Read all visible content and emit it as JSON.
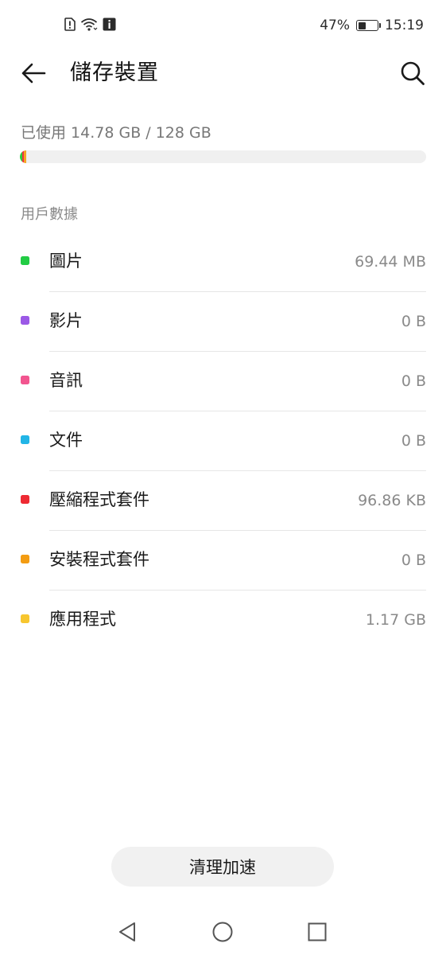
{
  "status_bar": {
    "battery_percent_text": "47%",
    "battery_level": 0.47,
    "time": "15:19",
    "icons": [
      "sim-alert-icon",
      "wifi-icon",
      "info-icon",
      "battery-icon"
    ]
  },
  "app_bar": {
    "title": "儲存裝置",
    "back_icon": "arrow-left-icon",
    "search_icon": "search-icon"
  },
  "storage": {
    "used_text": "已使用 14.78 GB / 128 GB",
    "used_fraction": 0.1155,
    "bar_segments": [
      {
        "name": "圖片",
        "color": "#2ecc40",
        "fraction": 0.006
      },
      {
        "name": "壓縮程式套件",
        "color": "#ee3344",
        "fraction": 0.004
      },
      {
        "name": "應用程式",
        "color": "#f5a623",
        "fraction": 0.006
      }
    ]
  },
  "section": {
    "header": "用戶數據"
  },
  "categories": [
    {
      "label": "圖片",
      "value": "69.44 MB",
      "color": "#22cc44"
    },
    {
      "label": "影片",
      "value": "0 B",
      "color": "#9b59e6"
    },
    {
      "label": "音訊",
      "value": "0 B",
      "color": "#f2558f"
    },
    {
      "label": "文件",
      "value": "0 B",
      "color": "#22b5e6"
    },
    {
      "label": "壓縮程式套件",
      "value": "96.86 KB",
      "color": "#ee2a33"
    },
    {
      "label": "安裝程式套件",
      "value": "0 B",
      "color": "#f39c12"
    },
    {
      "label": "應用程式",
      "value": "1.17 GB",
      "color": "#f7c62f"
    }
  ],
  "actions": {
    "clean_button": "清理加速"
  },
  "nav_bar": {
    "back_icon": "triangle-back-icon",
    "home_icon": "circle-home-icon",
    "recents_icon": "square-recents-icon"
  }
}
